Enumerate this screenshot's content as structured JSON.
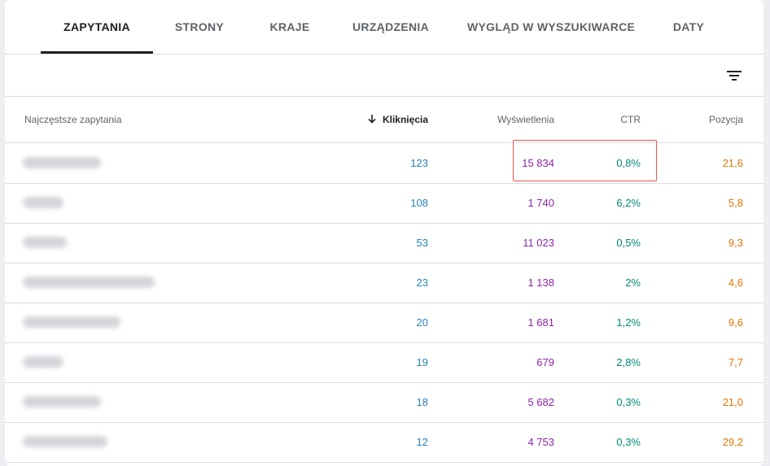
{
  "tabs": [
    {
      "label": "ZAPYTANIA",
      "active": true
    },
    {
      "label": "STRONY",
      "active": false
    },
    {
      "label": "KRAJE",
      "active": false
    },
    {
      "label": "URZĄDZENIA",
      "active": false
    },
    {
      "label": "WYGLĄD W WYSZUKIWARCE",
      "active": false
    },
    {
      "label": "DATY",
      "active": false
    }
  ],
  "toolbar": {
    "filter_icon": "filter-icon"
  },
  "table": {
    "columns": {
      "query": "Najczęstsze zapytania",
      "clicks": "Kliknięcia",
      "impressions": "Wyświetlenia",
      "ctr": "CTR",
      "position": "Pozycja"
    },
    "sort_icon": "arrow-down-icon",
    "rows": [
      {
        "clicks": "123",
        "impressions": "15 834",
        "ctr": "0,8%",
        "position": "21,6"
      },
      {
        "clicks": "108",
        "impressions": "1 740",
        "ctr": "6,2%",
        "position": "5,8"
      },
      {
        "clicks": "53",
        "impressions": "11 023",
        "ctr": "0,5%",
        "position": "9,3"
      },
      {
        "clicks": "23",
        "impressions": "1 138",
        "ctr": "2%",
        "position": "4,6"
      },
      {
        "clicks": "20",
        "impressions": "1 681",
        "ctr": "1,2%",
        "position": "9,6"
      },
      {
        "clicks": "19",
        "impressions": "679",
        "ctr": "2,8%",
        "position": "7,7"
      },
      {
        "clicks": "18",
        "impressions": "5 682",
        "ctr": "0,3%",
        "position": "21,0"
      },
      {
        "clicks": "12",
        "impressions": "4 753",
        "ctr": "0,3%",
        "position": "29,2"
      }
    ]
  },
  "colors": {
    "clicks": "#2a7fb8",
    "impressions": "#8e24aa",
    "ctr": "#00897b",
    "position": "#e37400",
    "highlight": "#e8574e"
  }
}
